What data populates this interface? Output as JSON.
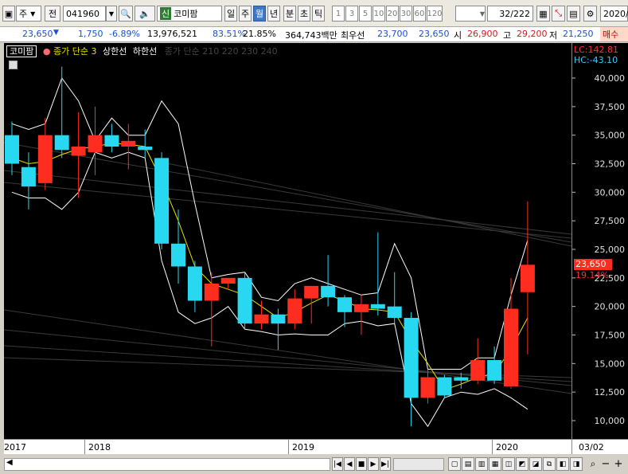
{
  "toolbar": {
    "period_type": "주",
    "prev_label": "전",
    "code": "041960",
    "badge": "신",
    "name": "코미팜",
    "period_tabs": [
      "일",
      "주",
      "월",
      "년",
      "분",
      "초",
      "틱"
    ],
    "active_tab": "월",
    "numbers": [
      "1",
      "3",
      "5",
      "10",
      "20",
      "30",
      "60",
      "120"
    ],
    "count": "32/222",
    "date": "2020/"
  },
  "quote": {
    "price": "23,650",
    "change": "1,750",
    "change_pct": "-6.89%",
    "volume": "13,976,521",
    "vol_ratio": "83.51%",
    "turnover_pct": "21.85%",
    "amount": "364,743백만",
    "pref_label": "최우선",
    "best_ask": "23,700",
    "best_bid": "23,650",
    "open_label": "시",
    "open": "26,900",
    "high_label": "고",
    "high": "29,200",
    "low_label": "저",
    "low": "21,250",
    "sell_label": "매수"
  },
  "legend": {
    "name": "코미팜",
    "ma": "종가 단순 3",
    "upper": "상한선",
    "lower": "하한선",
    "faint": "종가 단순 210 220 230 240"
  },
  "right_labels": {
    "lc": "LC:142.81",
    "hc": "HC:-43.10",
    "price": "23,650",
    "pct": "19.14%"
  },
  "x_labels": [
    "2017",
    "2018",
    "2019",
    "2020",
    "03/02"
  ],
  "colors": {
    "up": "#ff2d1f",
    "down": "#28d8f0",
    "ma": "#e8e000",
    "band": "#ffffff"
  },
  "chart_data": {
    "type": "candlestick",
    "ylim": [
      8500,
      43000
    ],
    "y_ticks": [
      "40,000",
      "37,500",
      "35,000",
      "32,500",
      "30,000",
      "27,500",
      "25,000",
      "22,500",
      "20,000",
      "17,500",
      "15,000",
      "12,500",
      "10,000"
    ],
    "candles": [
      {
        "o": 35000,
        "h": 36200,
        "l": 31500,
        "c": 32500
      },
      {
        "o": 32200,
        "h": 33500,
        "l": 28500,
        "c": 30500
      },
      {
        "o": 30800,
        "h": 36500,
        "l": 30200,
        "c": 35000
      },
      {
        "o": 35000,
        "h": 41000,
        "l": 33000,
        "c": 33700
      },
      {
        "o": 33200,
        "h": 37000,
        "l": 29500,
        "c": 34000
      },
      {
        "o": 33500,
        "h": 37500,
        "l": 31500,
        "c": 35000
      },
      {
        "o": 35000,
        "h": 36000,
        "l": 33500,
        "c": 34000
      },
      {
        "o": 34000,
        "h": 36000,
        "l": 32000,
        "c": 34500
      },
      {
        "o": 34000,
        "h": 35500,
        "l": 33000,
        "c": 33700
      },
      {
        "o": 33000,
        "h": 33500,
        "l": 25000,
        "c": 25500
      },
      {
        "o": 25500,
        "h": 28500,
        "l": 22000,
        "c": 23500
      },
      {
        "o": 23500,
        "h": 24000,
        "l": 19500,
        "c": 20500
      },
      {
        "o": 20500,
        "h": 23000,
        "l": 16500,
        "c": 22000
      },
      {
        "o": 22000,
        "h": 22500,
        "l": 21500,
        "c": 22500
      },
      {
        "o": 22500,
        "h": 23000,
        "l": 18000,
        "c": 18500
      },
      {
        "o": 18500,
        "h": 20500,
        "l": 18000,
        "c": 19300
      },
      {
        "o": 19300,
        "h": 19800,
        "l": 16200,
        "c": 18500
      },
      {
        "o": 18500,
        "h": 21500,
        "l": 18000,
        "c": 20700
      },
      {
        "o": 20700,
        "h": 21800,
        "l": 18500,
        "c": 21800
      },
      {
        "o": 21800,
        "h": 24500,
        "l": 20000,
        "c": 20800
      },
      {
        "o": 20800,
        "h": 21000,
        "l": 18200,
        "c": 19500
      },
      {
        "o": 19500,
        "h": 21000,
        "l": 17500,
        "c": 20200
      },
      {
        "o": 20200,
        "h": 26500,
        "l": 19200,
        "c": 19800
      },
      {
        "o": 20000,
        "h": 23000,
        "l": 18500,
        "c": 19000
      },
      {
        "o": 19000,
        "h": 19500,
        "l": 9500,
        "c": 12000
      },
      {
        "o": 12000,
        "h": 14500,
        "l": 11500,
        "c": 13800
      },
      {
        "o": 13800,
        "h": 14000,
        "l": 12000,
        "c": 12200
      },
      {
        "o": 13800,
        "h": 14200,
        "l": 12800,
        "c": 13500
      },
      {
        "o": 13500,
        "h": 17200,
        "l": 13200,
        "c": 15300
      },
      {
        "o": 15300,
        "h": 16500,
        "l": 13200,
        "c": 13500
      },
      {
        "o": 13000,
        "h": 22500,
        "l": 12800,
        "c": 19800
      },
      {
        "o": 21250,
        "h": 29200,
        "l": 15800,
        "c": 23650
      }
    ],
    "ma3": [
      33000,
      32500,
      32700,
      33300,
      33800,
      34000,
      34300,
      34200,
      34000,
      31000,
      27500,
      23500,
      22000,
      21500,
      21000,
      20000,
      19000,
      19500,
      20300,
      21000,
      20500,
      19800,
      19700,
      19500,
      17000,
      15000,
      12700,
      13200,
      13800,
      14100,
      16300,
      19000
    ],
    "upper": [
      36000,
      35500,
      36000,
      40000,
      38000,
      34500,
      36500,
      35000,
      35000,
      38000,
      36000,
      29000,
      22500,
      22800,
      23000,
      20800,
      20500,
      22000,
      22500,
      22000,
      21500,
      21000,
      21200,
      25500,
      22500,
      14500,
      14500,
      14500,
      15500,
      15500,
      21000,
      25800
    ],
    "lower": [
      30000,
      29500,
      29500,
      28500,
      30000,
      33500,
      33000,
      33500,
      33000,
      24000,
      19500,
      18500,
      19000,
      20000,
      18000,
      17800,
      17500,
      17600,
      17500,
      17500,
      18500,
      18700,
      18300,
      18500,
      11500,
      9500,
      12000,
      12500,
      12300,
      12800,
      12000,
      11000
    ]
  }
}
